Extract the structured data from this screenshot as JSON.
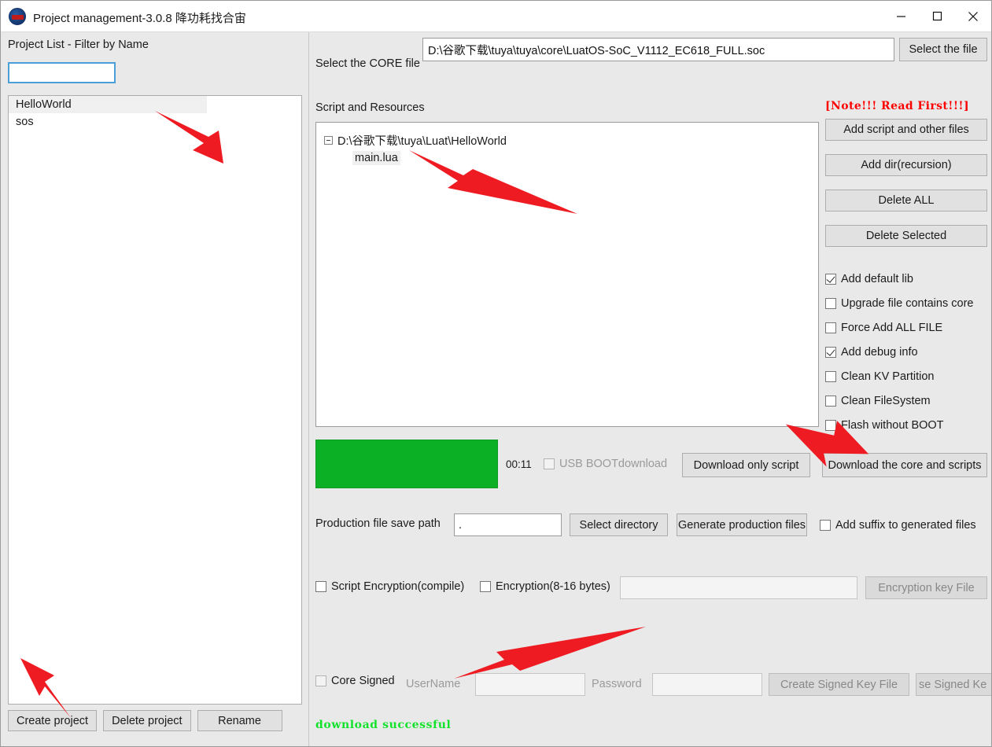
{
  "window": {
    "title": "Project management-3.0.8 降功耗找合宙",
    "icon": "app-logo-icon",
    "controls": {
      "minimize": "—",
      "maximize": "☐",
      "close": "✕"
    }
  },
  "left": {
    "filter_label": "Project List - Filter by Name",
    "filter_value": "",
    "filter_placeholder": "",
    "projects": [
      {
        "label": "HelloWorld",
        "selected": true
      },
      {
        "label": "sos",
        "selected": false
      }
    ],
    "buttons": {
      "create": "Create project",
      "delete": "Delete project",
      "rename": "Rename"
    }
  },
  "core": {
    "label": "Select the CORE file",
    "path_value": "D:\\谷歌下载\\tuya\\tuya\\core\\LuatOS-SoC_V1112_EC618_FULL.soc",
    "path_placeholder": "",
    "select_button": "Select the file"
  },
  "script": {
    "section_label": "Script and Resources",
    "note": "[Note!!! Read First!!!]",
    "tree": {
      "root": "D:\\谷歌下载\\tuya\\Luat\\HelloWorld",
      "root_expanded": true,
      "children": [
        {
          "label": "main.lua",
          "selected": true
        }
      ]
    },
    "side_buttons": [
      "Add script and other files",
      "Add dir(recursion)",
      "Delete ALL",
      "Delete Selected"
    ],
    "options": [
      {
        "label": "Add default lib",
        "checked": true,
        "disabled": false
      },
      {
        "label": "Upgrade file contains core",
        "checked": false,
        "disabled": false
      },
      {
        "label": "Force Add ALL FILE",
        "checked": false,
        "disabled": false
      },
      {
        "label": "Add debug info",
        "checked": true,
        "disabled": false
      },
      {
        "label": "Clean KV Partition",
        "checked": false,
        "disabled": false
      },
      {
        "label": "Clean FileSystem",
        "checked": false,
        "disabled": false
      },
      {
        "label": "Flash without BOOT",
        "checked": false,
        "disabled": false
      }
    ]
  },
  "download": {
    "progress_percent": 100,
    "progress_color": "#0cb024",
    "timer": "00:11",
    "usb_boot": {
      "label": "USB BOOTdownload",
      "checked": false,
      "disabled": true
    },
    "only_script_button": "Download only script",
    "core_and_scripts_button": "Download the core and scripts"
  },
  "production": {
    "label": "Production file save path",
    "path_value": ".",
    "path_placeholder": "",
    "select_directory_button": "Select directory",
    "generate_button": "Generate production files",
    "add_suffix": {
      "label": "Add suffix to generated files",
      "checked": false
    }
  },
  "encryption": {
    "script_encryption": {
      "label": "Script Encryption(compile)",
      "checked": false
    },
    "byte_encryption": {
      "label": "Encryption(8-16 bytes)",
      "checked": false
    },
    "key_value": "",
    "key_placeholder": "",
    "key_file_button": "Encryption key File"
  },
  "signing": {
    "core_signed": {
      "label": "Core Signed",
      "checked": false,
      "disabled": true
    },
    "username_label": "UserName",
    "username_value": "",
    "password_label": "Password",
    "password_value": "",
    "create_key_button": "Create Signed Key File",
    "use_key_button": "se Signed Ke"
  },
  "status": {
    "message": "download successful",
    "color": "#12e22b"
  }
}
